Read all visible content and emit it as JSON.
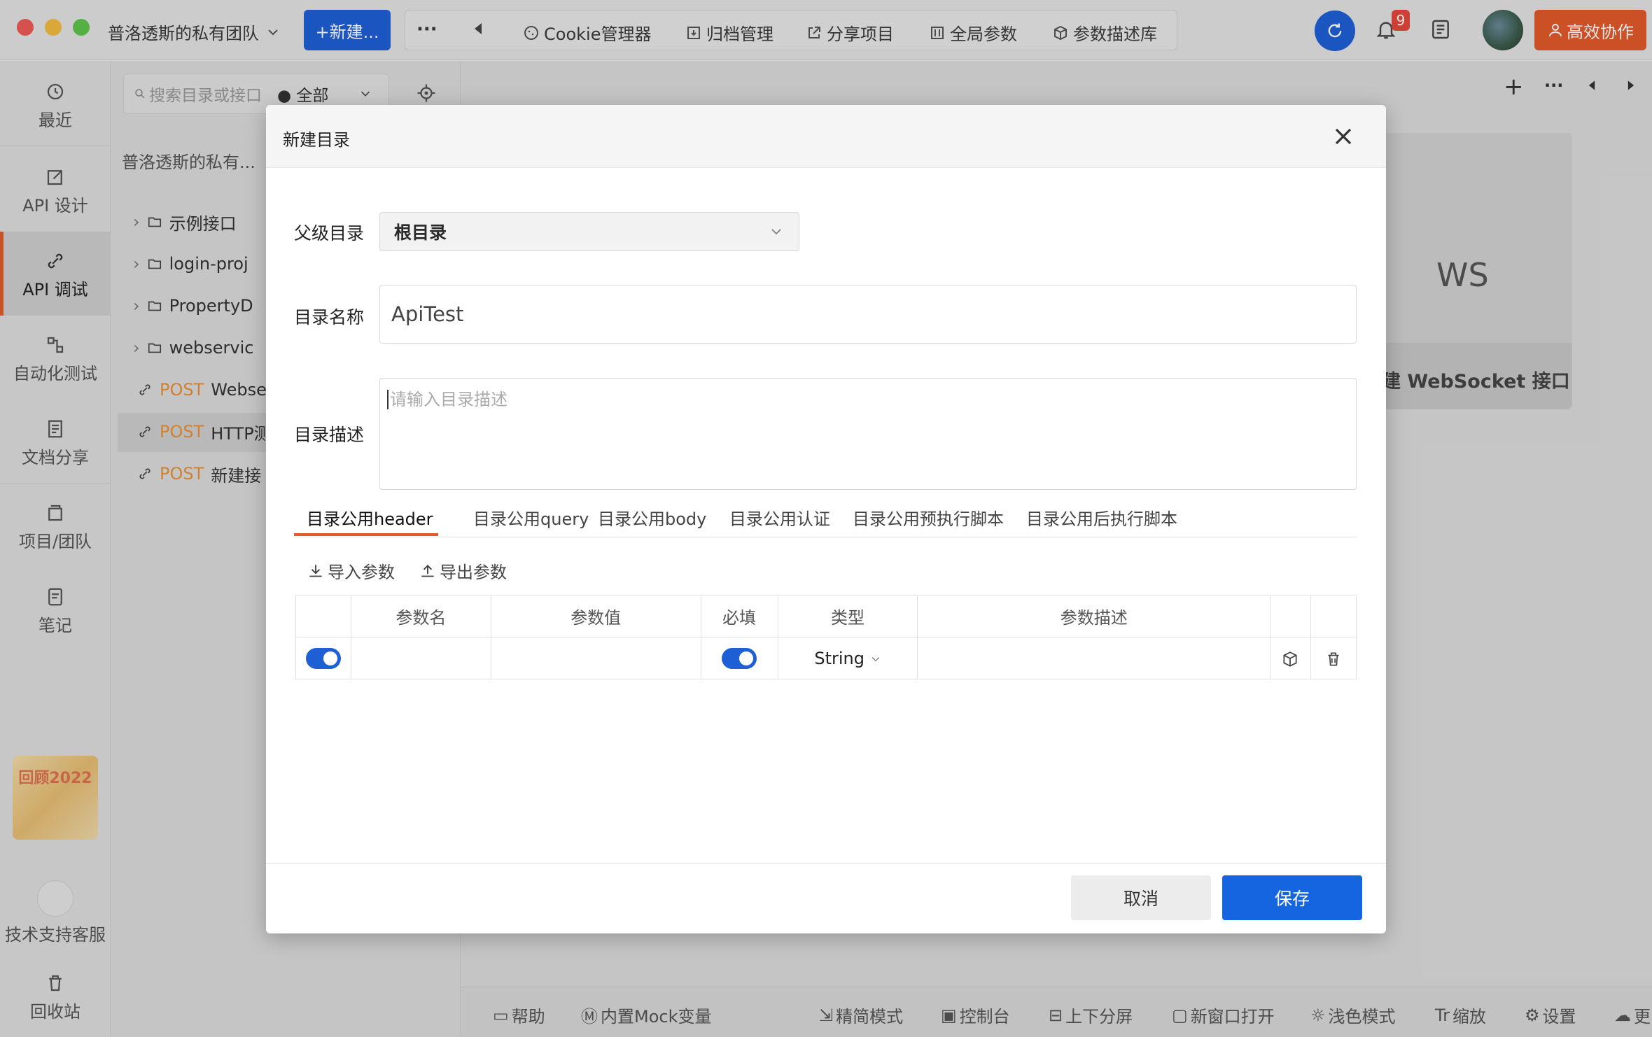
{
  "titlebar": {
    "team_name": "普洛透斯的私有团队",
    "new_button": "+新建...",
    "more": "···",
    "items": [
      "Cookie管理器",
      "归档管理",
      "分享项目",
      "全局参数",
      "参数描述库"
    ],
    "notification_count": "9",
    "collab_button": "高效协作"
  },
  "leftnav": {
    "items": [
      "最近",
      "API 设计",
      "API 调试",
      "自动化测试",
      "文档分享",
      "项目/团队",
      "笔记",
      "技术支持客服",
      "回收站"
    ],
    "promo_text": "回顾2022"
  },
  "tree": {
    "search_placeholder": "搜索目录或接口",
    "filter_value": "全部",
    "team_label": "普洛透斯的私有...",
    "folders": [
      "示例接口",
      "login-proj",
      "PropertyD",
      "webservic"
    ],
    "requests": [
      {
        "method": "POST",
        "name": "Webse"
      },
      {
        "method": "POST",
        "name": "HTTP测"
      },
      {
        "method": "POST",
        "name": "新建接"
      }
    ]
  },
  "right": {
    "ws_label": "WS",
    "ws_new": "建 WebSocket 接口"
  },
  "bottombar": [
    "帮助",
    "内置Mock变量",
    "精简模式",
    "控制台",
    "上下分屏",
    "新窗口打开",
    "浅色模式",
    "缩放",
    "设置",
    "更"
  ],
  "dialog": {
    "title": "新建目录",
    "parent_label": "父级目录",
    "parent_value": "根目录",
    "name_label": "目录名称",
    "name_value": "ApiTest",
    "desc_label": "目录描述",
    "desc_placeholder": "请输入目录描述",
    "tabs": [
      "目录公用header",
      "目录公用query",
      "目录公用body",
      "目录公用认证",
      "目录公用预执行脚本",
      "目录公用后执行脚本"
    ],
    "import_label": "导入参数",
    "export_label": "导出参数",
    "table": {
      "headers": [
        "参数名",
        "参数值",
        "必填",
        "类型",
        "参数描述"
      ],
      "row": {
        "type": "String"
      }
    },
    "cancel": "取消",
    "save": "保存"
  },
  "colors": {
    "accent": "#1f5fd6",
    "brand_orange": "#e35a2b",
    "post": "#e8913a"
  }
}
